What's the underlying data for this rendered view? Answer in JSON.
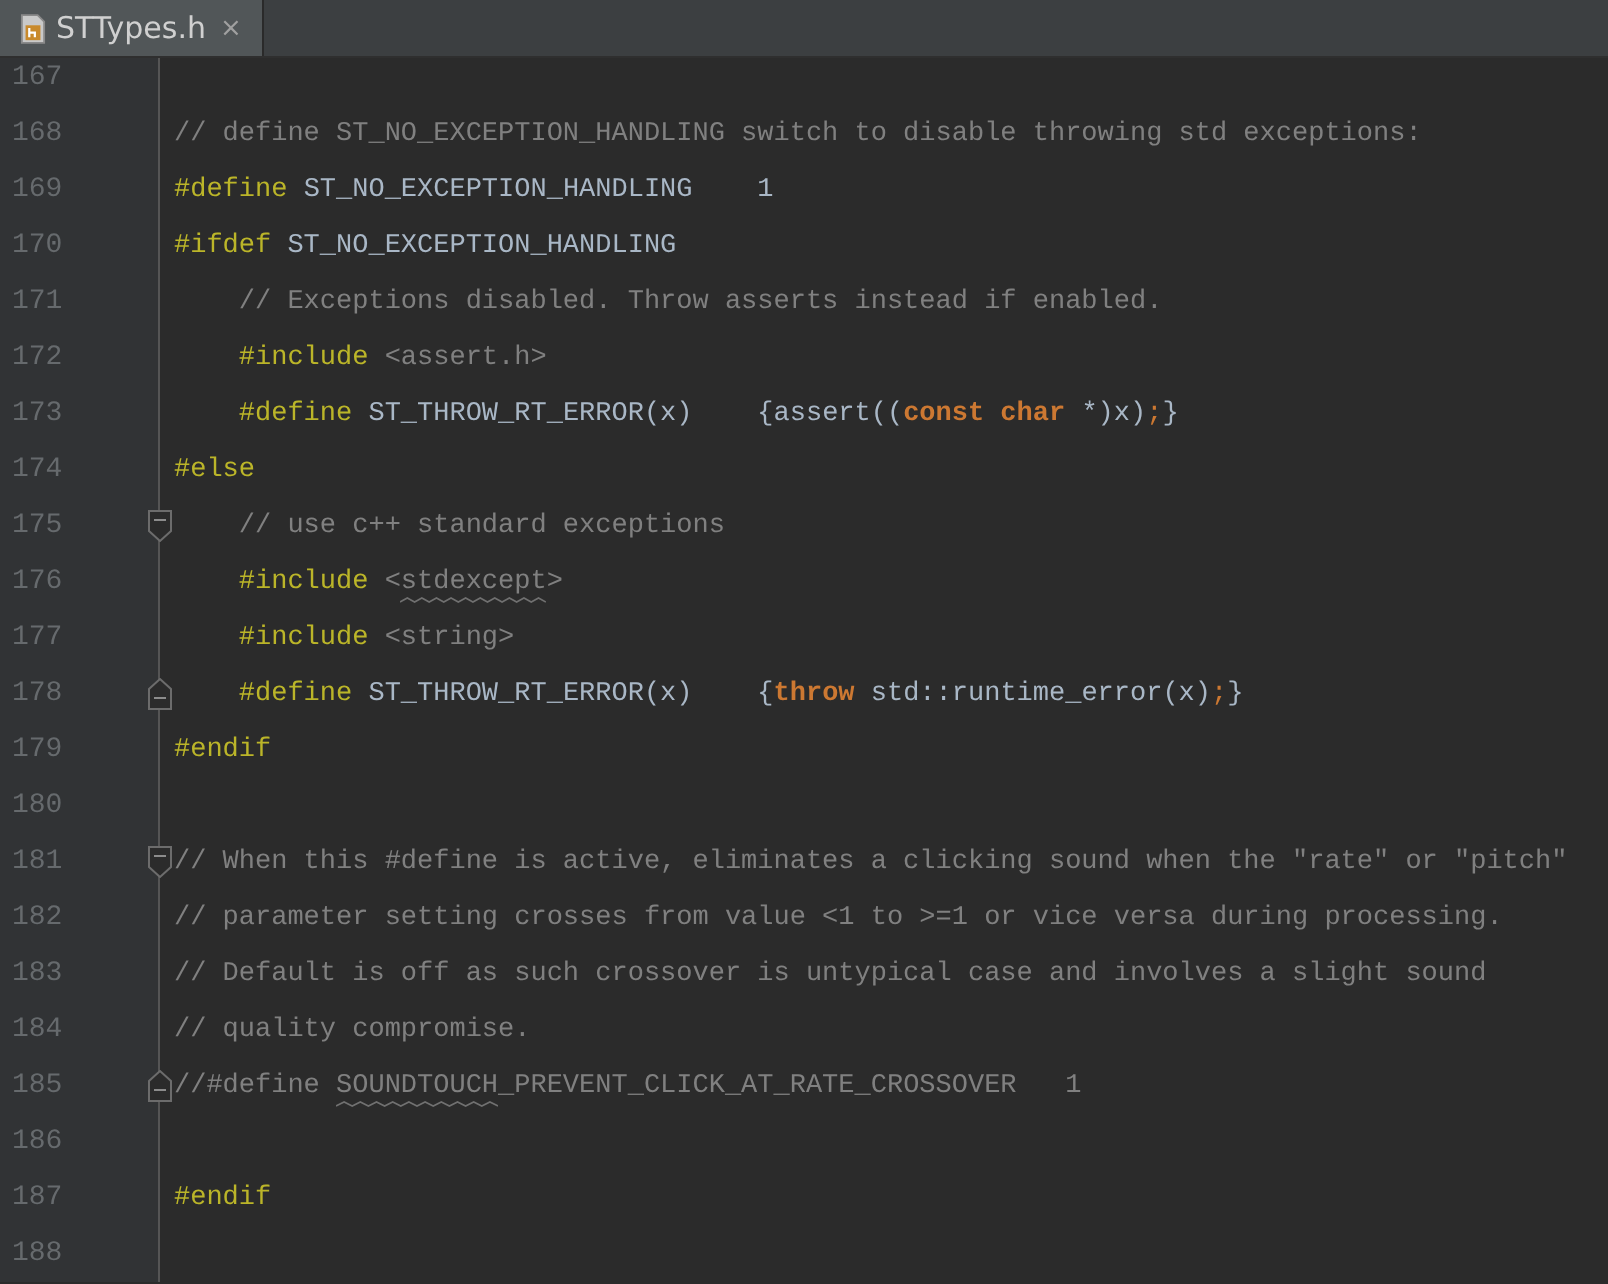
{
  "tabs": [
    {
      "label": "STTypes.h",
      "close": "×",
      "selected": true
    }
  ],
  "lines": [
    {
      "number": "167"
    },
    {
      "number": "168",
      "tokens": [
        {
          "kind": "comment",
          "text": "// define ST_NO_EXCEPTION_HANDLING switch to disable throwing std exceptions:"
        }
      ]
    },
    {
      "number": "169",
      "tokens": [
        {
          "kind": "directive",
          "text": "#define"
        },
        {
          "kind": "text",
          "text": " ST_NO_EXCEPTION_HANDLING    1"
        }
      ]
    },
    {
      "number": "170",
      "tokens": [
        {
          "kind": "directive",
          "text": "#ifdef"
        },
        {
          "kind": "text",
          "text": " ST_NO_EXCEPTION_HANDLING"
        }
      ]
    },
    {
      "number": "171",
      "tokens": [
        {
          "kind": "comment",
          "text": "    // Exceptions disabled. Throw asserts instead if enabled."
        }
      ]
    },
    {
      "number": "172",
      "tokens": [
        {
          "kind": "directive",
          "text": "    #include"
        },
        {
          "kind": "path",
          "text": " <assert.h>"
        }
      ]
    },
    {
      "number": "173",
      "tokens": [
        {
          "kind": "directive",
          "text": "    #define"
        },
        {
          "kind": "text",
          "text": " ST_THROW_RT_ERROR(x)    {assert(("
        },
        {
          "kind": "keyword",
          "text": "const char"
        },
        {
          "kind": "text",
          "text": " *)x)"
        },
        {
          "kind": "punct",
          "text": ";"
        },
        {
          "kind": "text",
          "text": "}"
        }
      ]
    },
    {
      "number": "174",
      "tokens": [
        {
          "kind": "directive",
          "text": "#else"
        }
      ]
    },
    {
      "number": "175",
      "fold_start": true,
      "tokens": [
        {
          "kind": "comment",
          "text": "    // use c++ standard exceptions"
        }
      ]
    },
    {
      "number": "176",
      "tokens": [
        {
          "kind": "directive",
          "text": "    #include"
        },
        {
          "kind": "path",
          "text": " <"
        },
        {
          "kind": "path",
          "text": "stdexcept",
          "warning": true
        },
        {
          "kind": "path",
          "text": ">"
        }
      ]
    },
    {
      "number": "177",
      "tokens": [
        {
          "kind": "directive",
          "text": "    #include"
        },
        {
          "kind": "path",
          "text": " <string>"
        }
      ]
    },
    {
      "number": "178",
      "fold_end": true,
      "tokens": [
        {
          "kind": "directive",
          "text": "    #define"
        },
        {
          "kind": "text",
          "text": " ST_THROW_RT_ERROR(x)    {"
        },
        {
          "kind": "keyword",
          "text": "throw"
        },
        {
          "kind": "text",
          "text": " std::runtime_error(x)"
        },
        {
          "kind": "punct",
          "text": ";"
        },
        {
          "kind": "text",
          "text": "}"
        }
      ]
    },
    {
      "number": "179",
      "tokens": [
        {
          "kind": "directive",
          "text": "#endif"
        }
      ]
    },
    {
      "number": "180"
    },
    {
      "number": "181",
      "fold_start": true,
      "tokens": [
        {
          "kind": "comment",
          "text": "// When this #define is active, eliminates a clicking sound when the \"rate\" or \"pitch\""
        }
      ]
    },
    {
      "number": "182",
      "tokens": [
        {
          "kind": "comment",
          "text": "// parameter setting crosses from value <1 to >=1 or vice versa during processing."
        }
      ]
    },
    {
      "number": "183",
      "tokens": [
        {
          "kind": "comment",
          "text": "// Default is off as such crossover is untypical case and involves a slight sound"
        }
      ]
    },
    {
      "number": "184",
      "tokens": [
        {
          "kind": "comment",
          "text": "// quality compromise."
        }
      ]
    },
    {
      "number": "185",
      "fold_end": true,
      "tokens": [
        {
          "kind": "comment",
          "text": "//#define "
        },
        {
          "kind": "comment",
          "text": "SOUNDTOUCH",
          "warning": true
        },
        {
          "kind": "comment",
          "text": "_PREVENT_CLICK_AT_RATE_CROSSOVER   1"
        }
      ]
    },
    {
      "number": "186"
    },
    {
      "number": "187",
      "tokens": [
        {
          "kind": "directive",
          "text": "#endif"
        }
      ]
    },
    {
      "number": "188"
    }
  ]
}
